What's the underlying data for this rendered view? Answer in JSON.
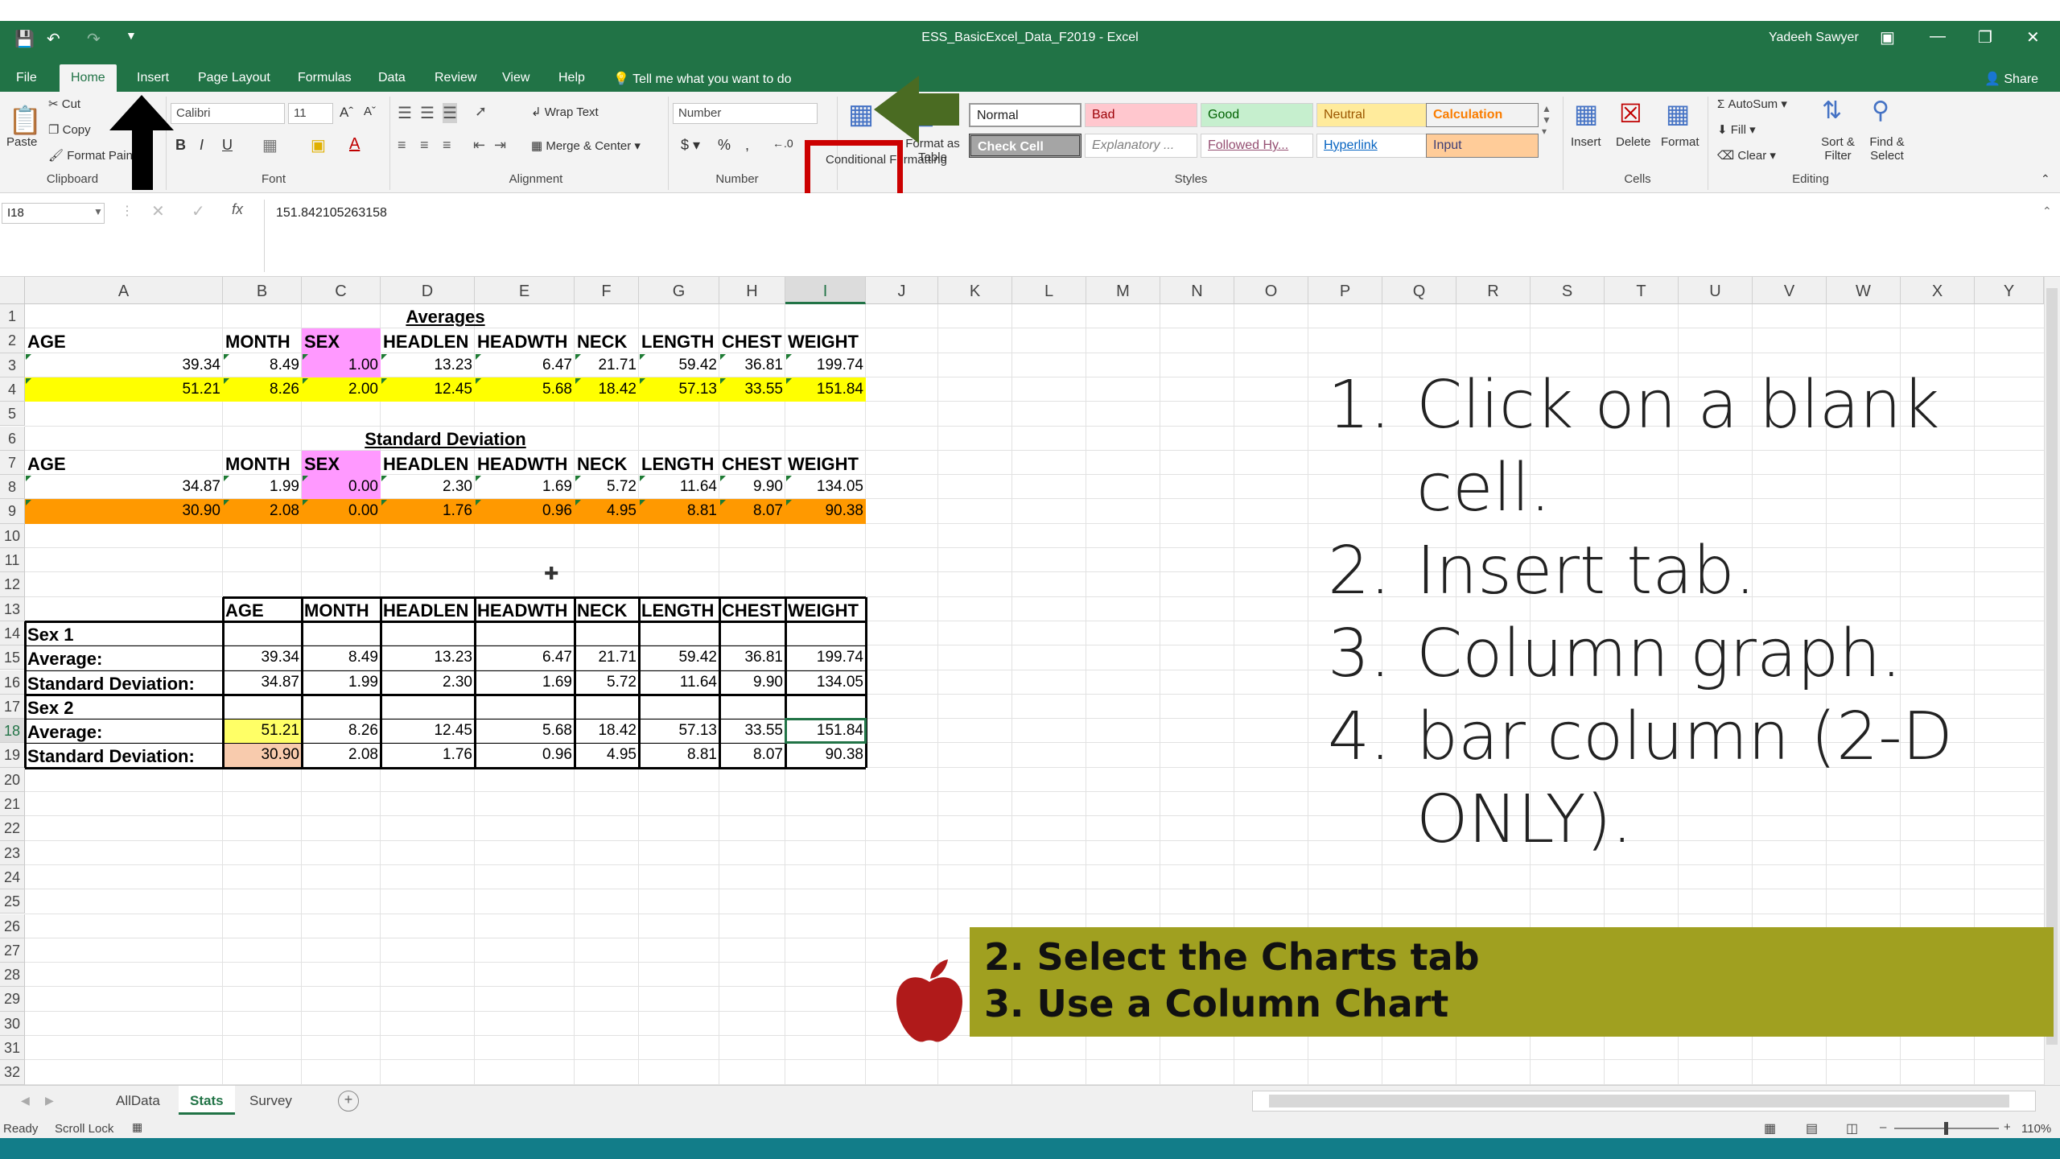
{
  "window": {
    "title": "ESS_BasicExcel_Data_F2019  -  Excel",
    "user": "Yadeeh Sawyer",
    "share": "Share"
  },
  "ribbon_tabs": [
    "File",
    "Home",
    "Insert",
    "Page Layout",
    "Formulas",
    "Data",
    "Review",
    "View",
    "Help"
  ],
  "tell_me": "Tell me what you want to do",
  "clipboard": {
    "paste": "Paste",
    "cut": "Cut",
    "copy": "Copy",
    "format_painter": "Format Painter",
    "group": "Clipboard"
  },
  "font": {
    "name": "Calibri",
    "size": "11",
    "group": "Font"
  },
  "alignment": {
    "wrap": "Wrap Text",
    "merge": "Merge & Center",
    "group": "Alignment"
  },
  "number": {
    "format": "Number",
    "group": "Number"
  },
  "styles": {
    "conditional": "Conditional Formatting",
    "format_table": "Format as Table",
    "normal": "Normal",
    "bad": "Bad",
    "good": "Good",
    "neutral": "Neutral",
    "calculation": "Calculation",
    "check_cell": "Check Cell",
    "explanatory": "Explanatory ...",
    "followed": "Followed Hy...",
    "hyperlink": "Hyperlink",
    "input": "Input",
    "group": "Styles"
  },
  "cells_group": {
    "insert": "Insert",
    "delete": "Delete",
    "format": "Format",
    "group": "Cells"
  },
  "editing": {
    "autosum": "AutoSum",
    "fill": "Fill",
    "clear": "Clear",
    "sort": "Sort & Filter",
    "find": "Find & Select",
    "group": "Editing"
  },
  "formula_bar": {
    "name_box": "I18",
    "value": "151.842105263158"
  },
  "columns": [
    "A",
    "B",
    "C",
    "D",
    "E",
    "F",
    "G",
    "H",
    "I",
    "J",
    "K",
    "L",
    "M",
    "N",
    "O",
    "P",
    "Q",
    "R",
    "S",
    "T",
    "U",
    "V",
    "W",
    "X",
    "Y"
  ],
  "rows": [
    "1",
    "2",
    "3",
    "4",
    "5",
    "6",
    "7",
    "8",
    "9",
    "10",
    "11",
    "12",
    "13",
    "14",
    "15",
    "16",
    "17",
    "18",
    "19",
    "20",
    "21",
    "22",
    "23",
    "24",
    "25",
    "26",
    "27",
    "28",
    "29",
    "30",
    "31",
    "32"
  ],
  "sheet": {
    "averages_title": "Averages",
    "std_title": "Standard Deviation",
    "header1": [
      "AGE",
      "MONTH",
      "SEX",
      "HEADLEN",
      "HEADWTH",
      "NECK",
      "LENGTH",
      "CHEST",
      "WEIGHT"
    ],
    "avg_row3": [
      "39.34",
      "8.49",
      "1.00",
      "13.23",
      "6.47",
      "21.71",
      "59.42",
      "36.81",
      "199.74"
    ],
    "avg_row4": [
      "51.21",
      "8.26",
      "2.00",
      "12.45",
      "5.68",
      "18.42",
      "57.13",
      "33.55",
      "151.84"
    ],
    "sd_row8": [
      "34.87",
      "1.99",
      "0.00",
      "2.30",
      "1.69",
      "5.72",
      "11.64",
      "9.90",
      "134.05"
    ],
    "sd_row9": [
      "30.90",
      "2.08",
      "0.00",
      "1.76",
      "0.96",
      "4.95",
      "8.81",
      "8.07",
      "90.38"
    ],
    "table_header": [
      "AGE",
      "MONTH",
      "HEADLEN",
      "HEADWTH",
      "NECK",
      "LENGTH",
      "CHEST",
      "WEIGHT"
    ],
    "sex1": "Sex 1",
    "sex2": "Sex 2",
    "average_label": "Average:",
    "std_label": "Standard Deviation:",
    "t_avg1": [
      "39.34",
      "8.49",
      "13.23",
      "6.47",
      "21.71",
      "59.42",
      "36.81",
      "199.74"
    ],
    "t_sd1": [
      "34.87",
      "1.99",
      "2.30",
      "1.69",
      "5.72",
      "11.64",
      "9.90",
      "134.05"
    ],
    "t_avg2": [
      "51.21",
      "8.26",
      "12.45",
      "5.68",
      "18.42",
      "57.13",
      "33.55",
      "151.84"
    ],
    "t_sd2": [
      "30.90",
      "2.08",
      "1.76",
      "0.96",
      "4.95",
      "8.81",
      "8.07",
      "90.38"
    ]
  },
  "sheet_tabs": [
    "AllData",
    "Stats",
    "Survey"
  ],
  "status": {
    "ready": "Ready",
    "scroll_lock": "Scroll Lock",
    "zoom": "110%"
  },
  "instructions": [
    {
      "num": "1.",
      "lines": [
        "Click on a blank",
        "cell."
      ]
    },
    {
      "num": "2.",
      "lines": [
        "Insert tab."
      ]
    },
    {
      "num": "3.",
      "lines": [
        "Column graph."
      ]
    },
    {
      "num": "4.",
      "lines": [
        "bar column (2-D",
        "ONLY)."
      ]
    }
  ],
  "mac_note": [
    "2. Select the Charts tab",
    "3.  Use a Column Chart"
  ],
  "colors": {
    "excel_green": "#217346",
    "yellow": "#ffff00",
    "orange": "#ff9900",
    "pink": "#ff99ff",
    "light_yellow": "#ffff66",
    "peach": "#f8cbad",
    "note_bg": "#a0a020",
    "apple_red": "#b01a1a",
    "arrow_green": "#4a6b22",
    "highlight_red": "#cc0000"
  }
}
